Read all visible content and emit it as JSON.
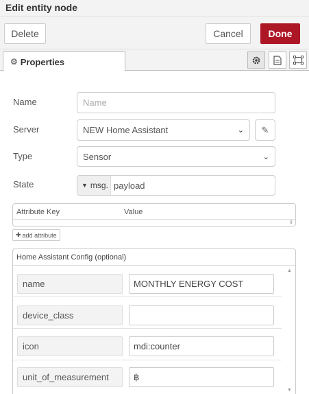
{
  "window": {
    "title": "Edit entity node"
  },
  "actions": {
    "delete": "Delete",
    "cancel": "Cancel",
    "done": "Done"
  },
  "tabs": {
    "properties": "Properties"
  },
  "form": {
    "name_label": "Name",
    "name_placeholder": "Name",
    "server_label": "Server",
    "server_value": "NEW Home Assistant",
    "type_label": "Type",
    "type_value": "Sensor",
    "state_label": "State",
    "state_type": "msg.",
    "state_value": "payload"
  },
  "attributes": {
    "key_header": "Attribute Key",
    "value_header": "Value",
    "add_button": "add attribute"
  },
  "ha_config": {
    "header": "Home Assistant Config (optional)",
    "rows": [
      {
        "key": "name",
        "value": "MONTHLY ENERGY COST"
      },
      {
        "key": "device_class",
        "value": ""
      },
      {
        "key": "icon",
        "value": "mdi:counter"
      },
      {
        "key": "unit_of_measurement",
        "value": "฿"
      }
    ]
  },
  "icons": [
    "gear-icon",
    "description-icon",
    "appearance-icon",
    "pencil-icon",
    "plus-icon",
    "caret-down-icon"
  ],
  "colors": {
    "done_button": "#ad1625",
    "toolbar_bg": "#f3f3f3"
  }
}
